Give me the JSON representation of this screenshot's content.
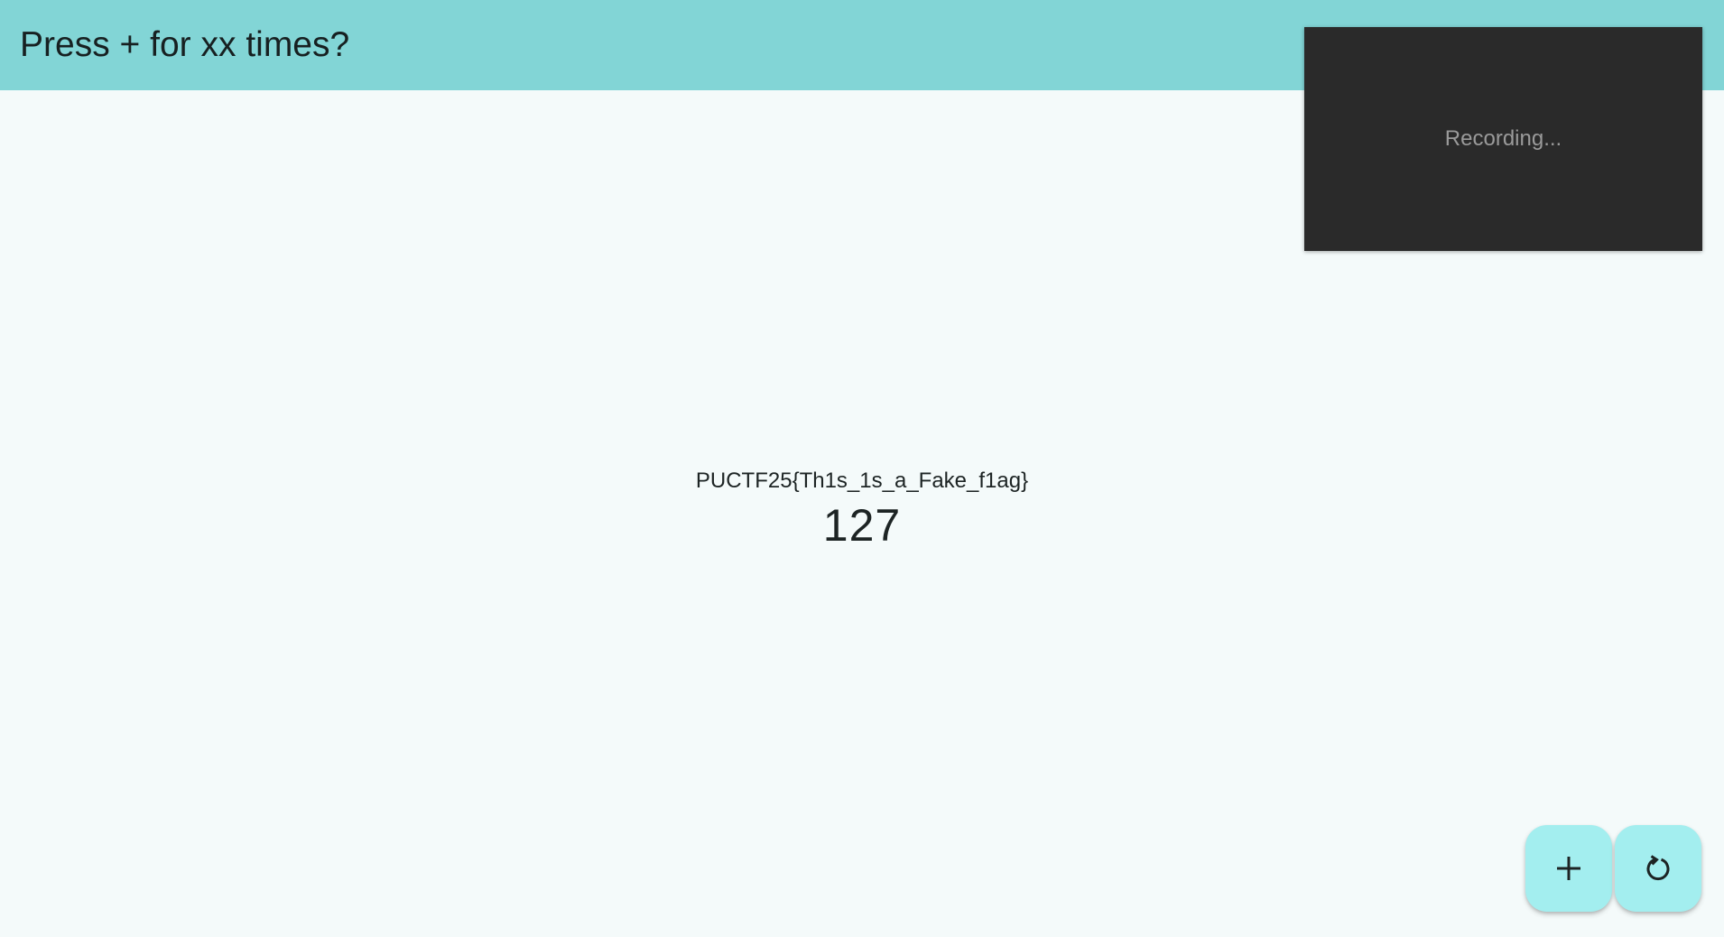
{
  "appbar": {
    "title": "Press + for xx times?",
    "background": "#82d5d6"
  },
  "main": {
    "flag_text": "PUCTF25{Th1s_1s_a_Fake_f1ag}",
    "counter": "127"
  },
  "recording_overlay": {
    "status_text": "Recording...",
    "background": "#2a2a2a"
  },
  "actions": {
    "increment_icon": "plus-icon",
    "reset_icon": "refresh-icon",
    "button_color": "#a3eeef"
  }
}
